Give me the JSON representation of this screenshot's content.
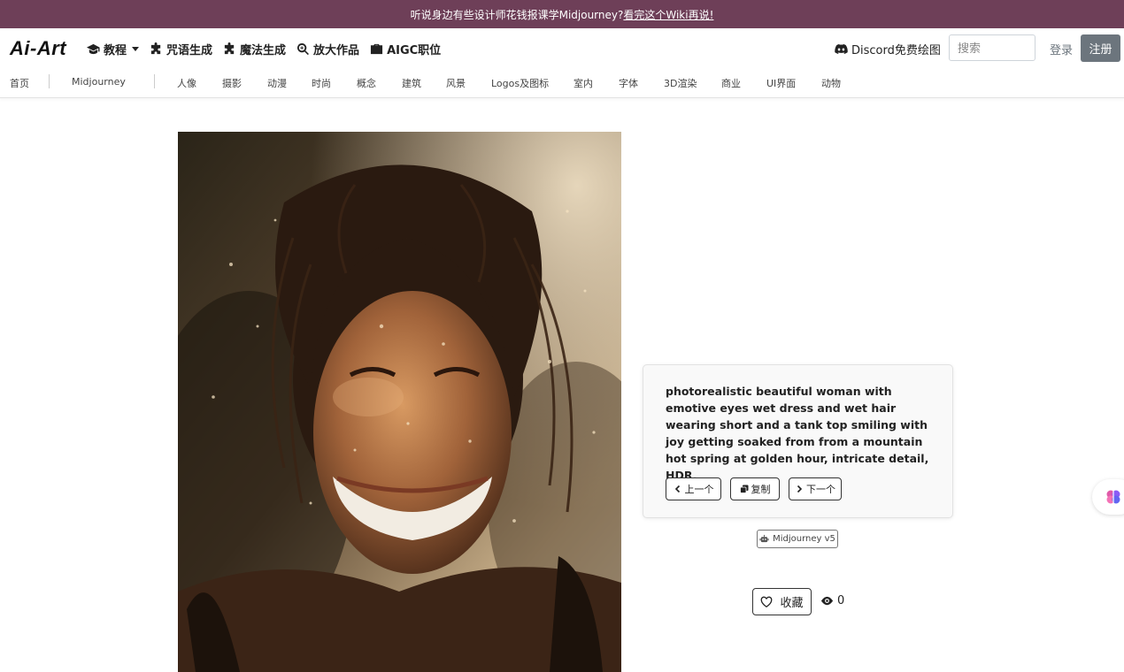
{
  "banner": {
    "text": "听说身边有些设计师花钱报课学Midjourney?",
    "link": "看完这个Wiki再说!"
  },
  "header": {
    "logo": "Ai-Art",
    "menu": [
      {
        "label": "教程",
        "icon": "graduation-cap-icon"
      },
      {
        "label": "咒语生成",
        "icon": "puzzle-icon"
      },
      {
        "label": "魔法生成",
        "icon": "puzzle-icon"
      },
      {
        "label": "放大作品",
        "icon": "zoom-icon"
      },
      {
        "label": "AIGC职位",
        "icon": "briefcase-icon"
      }
    ],
    "discord_label": "Discord免费绘图",
    "search_placeholder": "搜索",
    "login_label": "登录",
    "register_label": "注册"
  },
  "categories": [
    "首页",
    "Midjourney",
    "人像",
    "摄影",
    "动漫",
    "时尚",
    "概念",
    "建筑",
    "风景",
    "Logos及图标",
    "室内",
    "字体",
    "3D渲染",
    "商业",
    "UI界面",
    "动物"
  ],
  "prompt_card": {
    "text": "photorealistic beautiful woman with emotive eyes wet dress and wet hair wearing short and a tank top smiling with joy getting soaked from from a mountain hot spring at golden hour, intricate detail, HDR,",
    "prev_label": "上一个",
    "copy_label": "复制",
    "next_label": "下一个"
  },
  "model_badge": "Midjourney v5",
  "favorite_label": "收藏",
  "views_count": "0",
  "colors": {
    "banner_bg": "#6e3f58",
    "register_bg": "#6c757d"
  }
}
